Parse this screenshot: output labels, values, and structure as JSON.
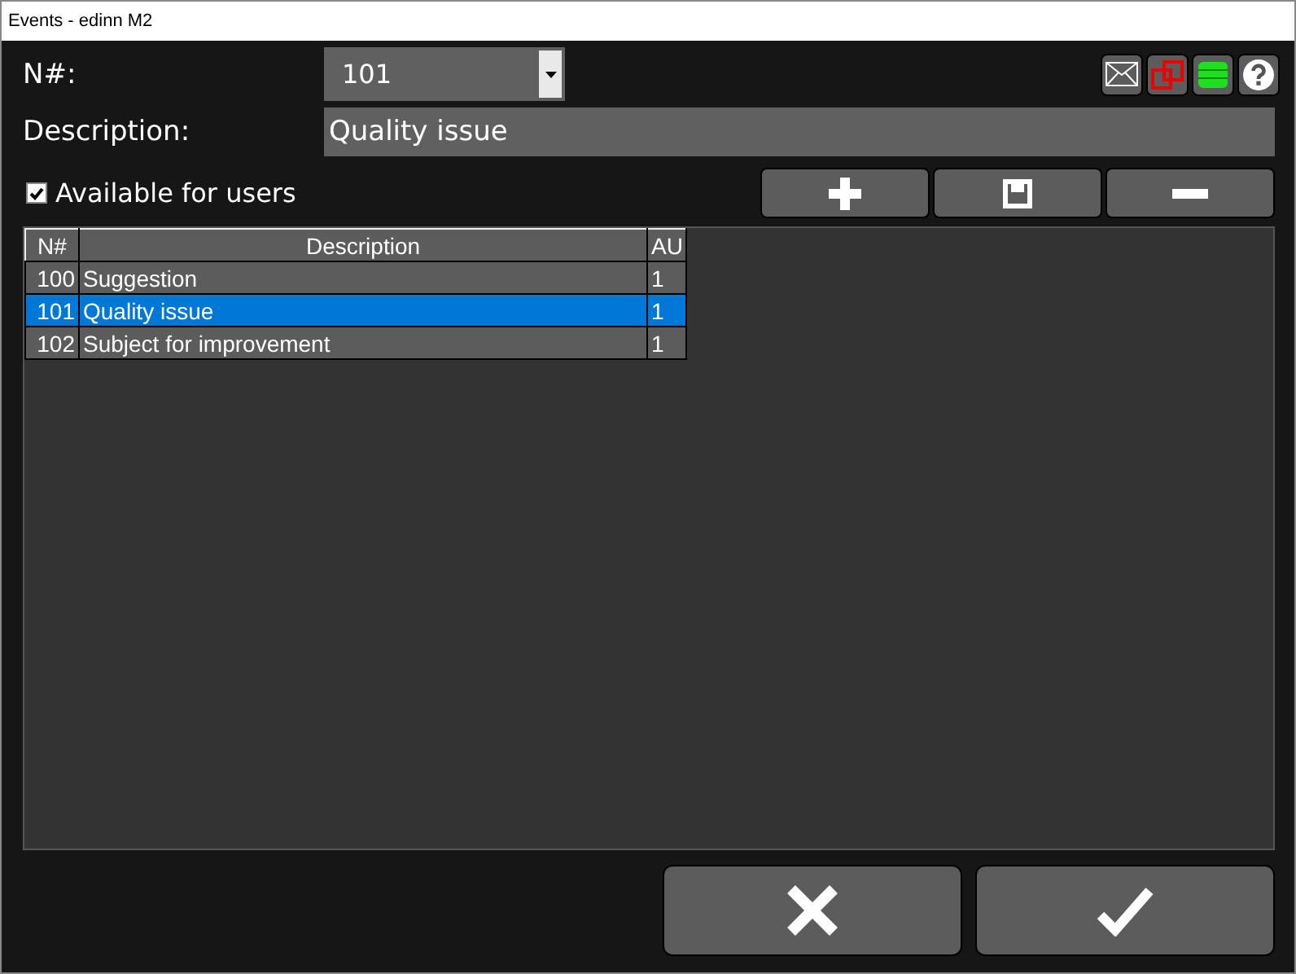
{
  "window": {
    "title": "Events - edinn M2"
  },
  "number": {
    "label": "N#:",
    "value": "101"
  },
  "description": {
    "label": "Description:",
    "value": "Quality issue"
  },
  "available_for_users": {
    "label": "Available for users",
    "checked": true
  },
  "table": {
    "columns": [
      "N#",
      "Description",
      "AU"
    ],
    "rows": [
      {
        "cells": [
          "100",
          "Suggestion",
          "1"
        ],
        "selected": false
      },
      {
        "cells": [
          "101",
          "Quality issue",
          "1"
        ],
        "selected": true
      },
      {
        "cells": [
          "102",
          "Subject for improvement",
          "1"
        ],
        "selected": false
      }
    ]
  }
}
